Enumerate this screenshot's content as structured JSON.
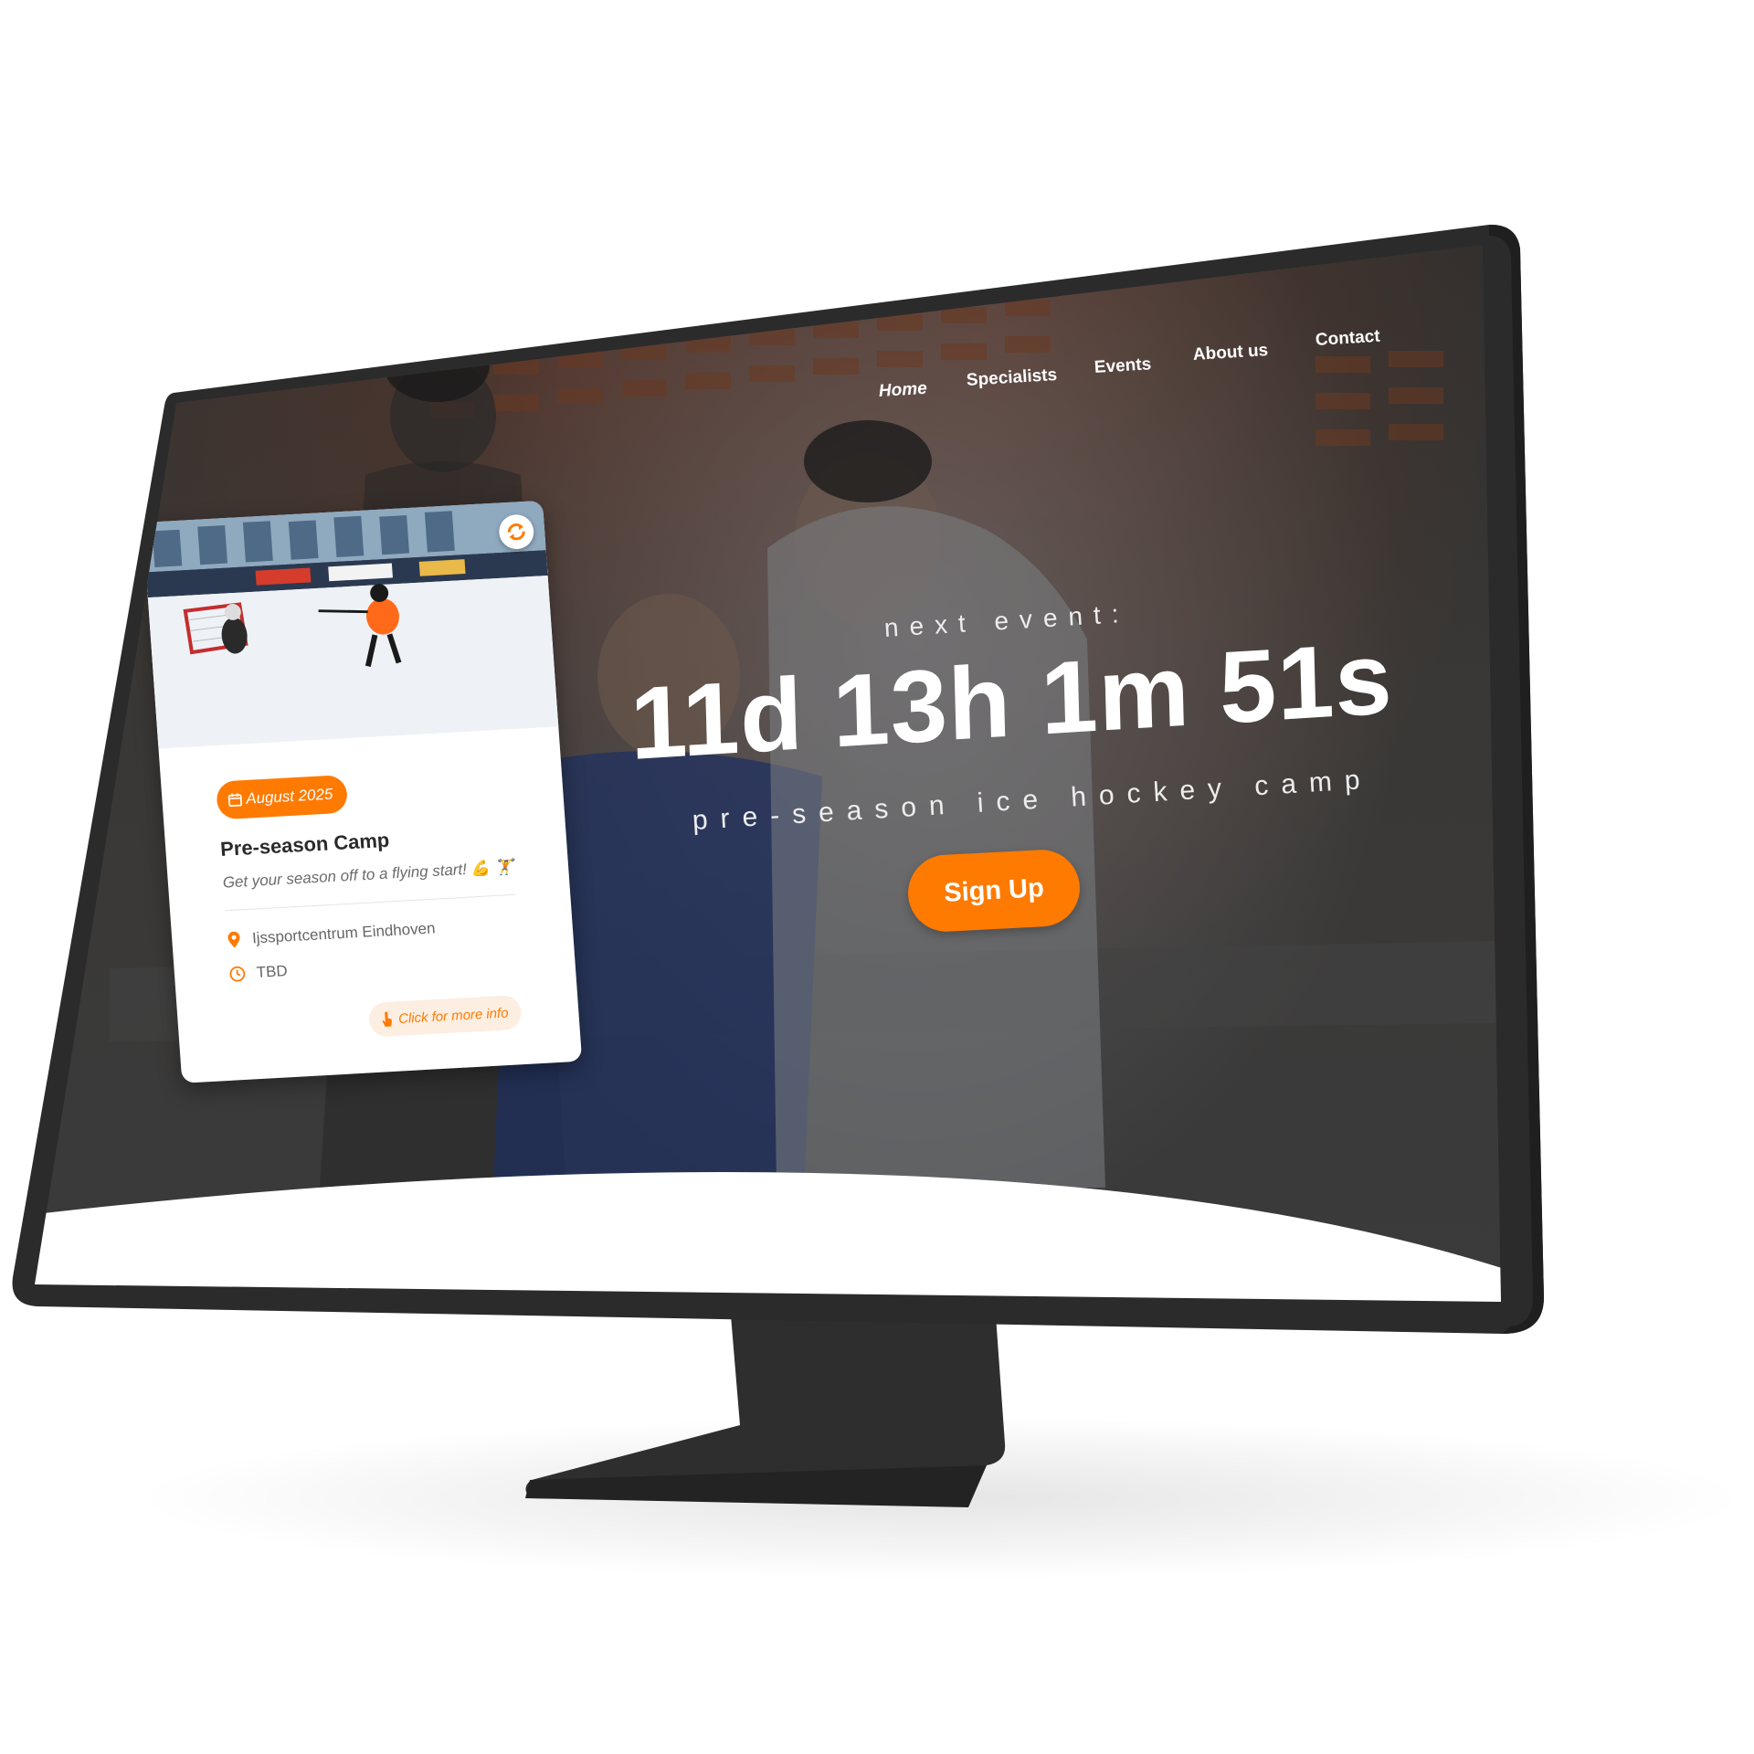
{
  "nav": {
    "items": [
      {
        "label": "Home"
      },
      {
        "label": "Specialists"
      },
      {
        "label": "Events"
      },
      {
        "label": "About us"
      },
      {
        "label": "Contact"
      }
    ]
  },
  "hero": {
    "label": "next event:",
    "countdown": "11d 13h 1m 51s",
    "subtitle": "pre-season ice hockey camp",
    "signup_label": "Sign Up"
  },
  "event_card": {
    "date_badge": "August 2025",
    "title": "Pre-season Camp",
    "description": "Get your season off to a flying start! 💪 🏋",
    "location": "Ijssportcentrum Eindhoven",
    "time": "TBD",
    "more_info_label": "Click for more info"
  },
  "colors": {
    "accent": "#ff7a00",
    "monitor_bezel": "#2b2b2b",
    "overlay": "#333333"
  },
  "icons": {
    "calendar": "calendar-icon",
    "sync": "sync-icon",
    "location": "location-pin-icon",
    "clock": "clock-icon",
    "pointer": "pointer-hand-icon"
  }
}
